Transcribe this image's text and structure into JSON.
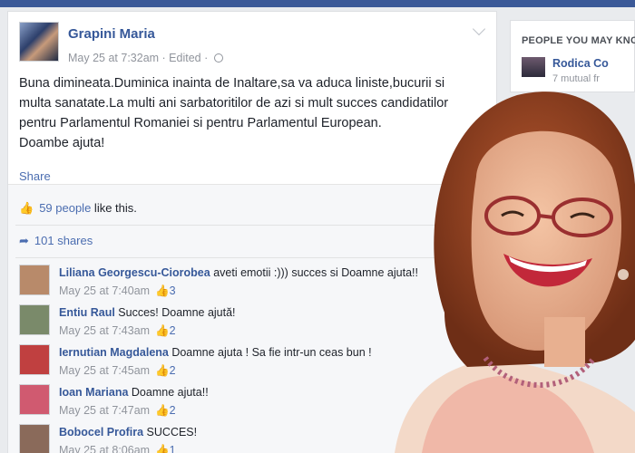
{
  "post": {
    "author": "Grapini Maria",
    "meta": "May 25 at 7:32am · Edited ·",
    "text_lines": [
      "Buna dimineata.Duminica inainta de Inaltare,sa va aduca liniste,bucurii si",
      "multa sanatate.La multi ani sarbatoritilor de azi si mult succes candidatilor",
      "pentru Parlamentul Romaniei si pentru Parlamentul European.",
      "Doambe ajuta!"
    ],
    "share_label": "Share"
  },
  "feedback": {
    "likes_count": "59 people",
    "likes_suffix": " like this.",
    "shares": "101 shares"
  },
  "comments": [
    {
      "name": "Liliana Georgescu-Ciorobea",
      "text": " aveti emotii :))) succes si Doamne ajuta!!",
      "time": "May 25 at 7:40am",
      "likes": "3",
      "avatar_color": "#b88a6a"
    },
    {
      "name": "Entiu Raul",
      "text": " Succes! Doamne ajută!",
      "time": "May 25 at 7:43am",
      "likes": "2",
      "avatar_color": "#7a8a6a"
    },
    {
      "name": "Iernutian Magdalena",
      "text": " Doamne ajuta ! Sa fie intr-un ceas bun !",
      "time": "May 25 at 7:45am",
      "likes": "2",
      "avatar_color": "#c04040"
    },
    {
      "name": "Ioan Mariana",
      "text": " Doamne ajuta!!",
      "time": "May 25 at 7:47am",
      "likes": "2",
      "avatar_color": "#d05a70"
    },
    {
      "name": "Bobocel Profira",
      "text": " SUCCES!",
      "time": "May 25 at 8:06am",
      "likes": "1",
      "avatar_color": "#8a6a5a"
    }
  ],
  "sidebar": {
    "title": "PEOPLE YOU MAY KNO",
    "person_name": "Rodica Co",
    "person_sub": "7 mutual fr"
  },
  "colors": {
    "facebook_blue": "#3b5998",
    "link_blue": "#365899",
    "background": "#e9ebee"
  }
}
